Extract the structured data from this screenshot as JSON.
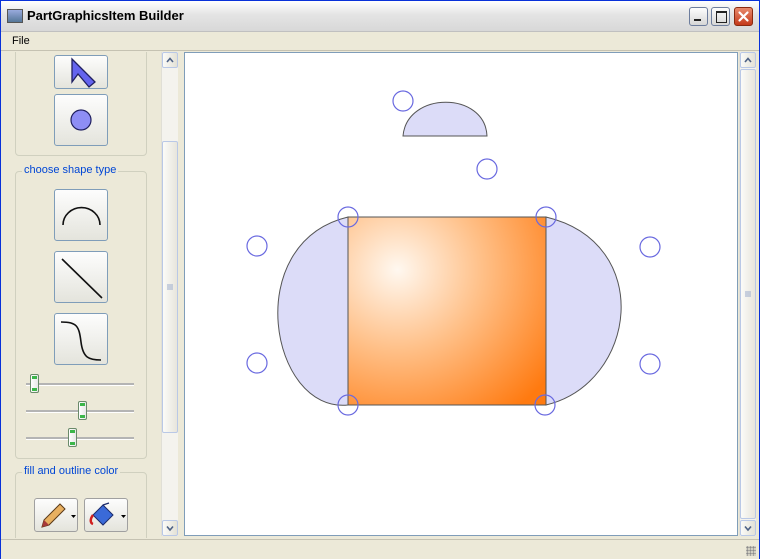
{
  "window": {
    "title": "PartGraphicsItem Builder",
    "icon": "app-window-icon",
    "controls": [
      "minimize-icon",
      "maximize-icon",
      "close-icon"
    ]
  },
  "menu": {
    "file_label": "File"
  },
  "left_panel": {
    "tools": [
      "select-arrow-icon",
      "circle-node-icon"
    ],
    "shape_group": {
      "title": "choose shape type",
      "shapes": [
        "arc-shape-icon",
        "line-shape-icon",
        "curve-shape-icon"
      ],
      "slider_levels": [
        0.04,
        0.53,
        0.42
      ]
    },
    "color_group": {
      "title": "fill and outline color",
      "buttons": [
        "pencil-outline-color-icon",
        "paint-bucket-fill-icon"
      ]
    }
  },
  "colors": {
    "title_bar": "#e4e4e4",
    "group_title": "#0046d5",
    "handle_stroke": "#6a6ae0",
    "shape_fill": "#dcdcf8",
    "gradient_light": "#fff5ec",
    "gradient_dark": "#ff7a10"
  }
}
